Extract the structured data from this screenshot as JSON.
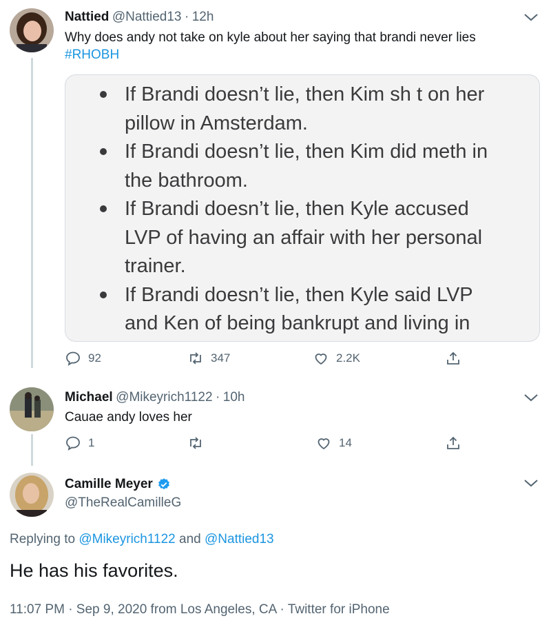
{
  "tweet1": {
    "name": "Nattied",
    "handle": "@Nattied13",
    "time": "12h",
    "text": "Why does andy not take on kyle about her saying that brandi never lies",
    "hashtag": "#RHOBH",
    "media_bullets": [
      {
        "line1": "If Brandi doesn’t lie, then Kim sh t on her",
        "line2": "pillow in Amsterdam."
      },
      {
        "line1": "If Brandi doesn’t lie, then Kim did meth in",
        "line2": "the bathroom."
      },
      {
        "line1": "If Brandi doesn’t lie, then Kyle accused",
        "line2": "LVP of having an affair with her personal",
        "line3": "trainer."
      },
      {
        "line1": "If Brandi doesn’t lie, then Kyle said LVP",
        "line2": "and Ken of being bankrupt and living in"
      }
    ],
    "replies": "92",
    "retweets": "347",
    "likes": "2.2K"
  },
  "tweet2": {
    "name": "Michael",
    "handle": "@Mikeyrich1122",
    "time": "10h",
    "text": "Cauae andy loves her",
    "replies": "1",
    "retweets": "",
    "likes": "14"
  },
  "tweet3": {
    "name": "Camille Meyer",
    "handle": "@TheRealCamilleG",
    "replying_prefix": "Replying to ",
    "replying_user1": "@Mikeyrich1122",
    "replying_and": " and ",
    "replying_user2": "@Nattied13",
    "text": "He has his favorites.",
    "timestamp": "11:07 PM · Sep 9, 2020 from Los Angeles, CA · Twitter for iPhone"
  },
  "colors": {
    "link": "#1b95e0",
    "verified": "#1d9bf0",
    "muted": "#536471"
  },
  "icons": [
    "chevron-down-icon",
    "reply-icon",
    "retweet-icon",
    "like-icon",
    "share-icon",
    "verified-badge-icon"
  ]
}
